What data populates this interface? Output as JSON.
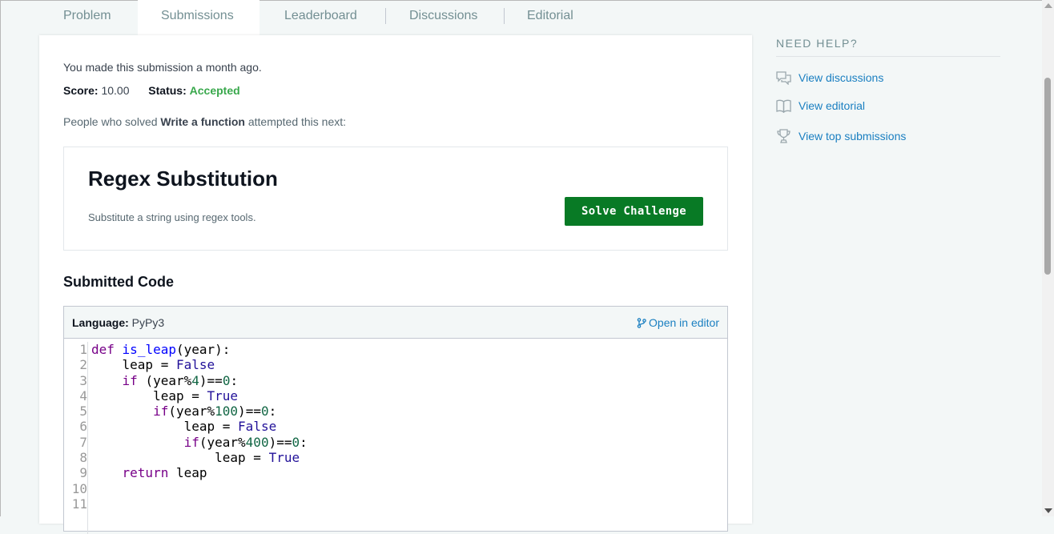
{
  "tabs": [
    "Problem",
    "Submissions",
    "Leaderboard",
    "Discussions",
    "Editorial"
  ],
  "submission": {
    "message": "You made this submission a month ago.",
    "score_label": "Score:",
    "score_value": "10.00",
    "status_label": "Status:",
    "status_value": "Accepted"
  },
  "people_line": {
    "before": "People who solved ",
    "challenge": "Write a function",
    "after": " attempted this next:"
  },
  "next_challenge": {
    "title": "Regex Substitution",
    "subtitle": "Substitute a string using regex tools.",
    "button": "Solve Challenge"
  },
  "submitted_code": {
    "heading": "Submitted Code",
    "language_label": "Language:",
    "language_value": "PyPy3",
    "open_editor": "Open in editor",
    "line_numbers": [
      "1",
      "2",
      "3",
      "4",
      "5",
      "6",
      "7",
      "8",
      "9",
      "10",
      "11"
    ],
    "lines": [
      "def is_leap(year):",
      "    leap = False",
      "    if (year%4)==0:",
      "        leap = True",
      "        if(year%100)==0:",
      "            leap = False",
      "            if(year%400)==0:",
      "                leap = True",
      "    return leap",
      "",
      ""
    ]
  },
  "help": {
    "title": "NEED HELP?",
    "links": [
      {
        "label": "View discussions",
        "icon": "discussion-icon"
      },
      {
        "label": "View editorial",
        "icon": "book-icon"
      },
      {
        "label": "View top submissions",
        "icon": "trophy-icon"
      }
    ]
  },
  "colors": {
    "accepted": "#39a84c",
    "button": "#087a25",
    "link": "#1a7fc1"
  }
}
